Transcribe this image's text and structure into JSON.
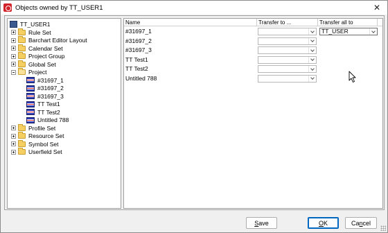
{
  "window": {
    "title": "Objects owned by TT_USER1",
    "close_glyph": "✕"
  },
  "tree": {
    "root": "TT_USER1",
    "items": [
      {
        "label": "Rule Set",
        "expanded": false
      },
      {
        "label": "Barchart Editor Layout",
        "expanded": false
      },
      {
        "label": "Calendar Set",
        "expanded": false
      },
      {
        "label": "Project Group",
        "expanded": false
      },
      {
        "label": "Global Set",
        "expanded": false
      },
      {
        "label": "Project",
        "expanded": true
      },
      {
        "label": "#31697_1",
        "child": true
      },
      {
        "label": "#31697_2",
        "child": true
      },
      {
        "label": "#31697_3",
        "child": true
      },
      {
        "label": "TT Test1",
        "child": true
      },
      {
        "label": "TT Test2",
        "child": true
      },
      {
        "label": "Untitled 788",
        "child": true
      },
      {
        "label": "Profile Set",
        "expanded": false
      },
      {
        "label": "Resource Set",
        "expanded": false
      },
      {
        "label": "Symbol Set",
        "expanded": false
      },
      {
        "label": "Userfield Set",
        "expanded": false
      }
    ]
  },
  "grid": {
    "columns": [
      "Name",
      "Transfer to ...",
      "Transfer all to"
    ],
    "rows": [
      "#31697_1",
      "#31697_2",
      "#31697_3",
      "TT Test1",
      "TT Test2",
      "Untitled 788"
    ],
    "transfer_all_value": "TT_USER"
  },
  "buttons": {
    "save": {
      "u": "S",
      "rest": "ave"
    },
    "ok": {
      "u": "O",
      "rest": "K"
    },
    "cancel": {
      "pre": "Ca",
      "u": "n",
      "rest": "cel"
    }
  },
  "icons": {
    "app": "app-logo-icon",
    "folder": "folder-icon",
    "project": "project-icon",
    "cursor": "mouse-pointer-icon"
  }
}
